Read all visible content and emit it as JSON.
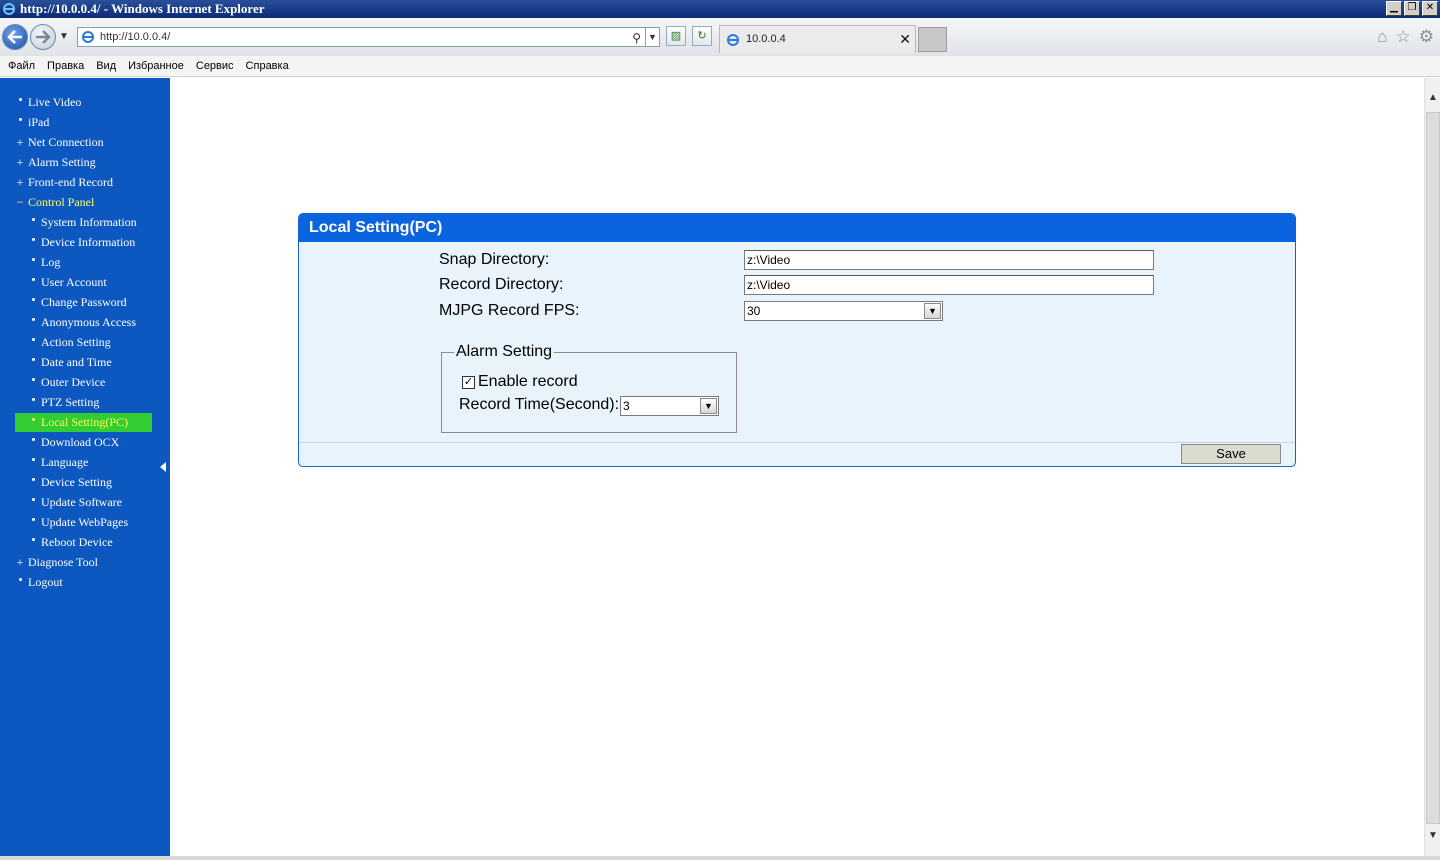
{
  "window": {
    "title": "http://10.0.0.4/ - Windows Internet Explorer",
    "buttons": {
      "minimize": "▁",
      "restore": "❐",
      "close": "✕"
    }
  },
  "browser": {
    "address": "http://10.0.0.4/",
    "tab_title": "10.0.0.4",
    "tab_close": "✕"
  },
  "menu": [
    "Файл",
    "Правка",
    "Вид",
    "Избранное",
    "Сервис",
    "Справка"
  ],
  "sidebar": {
    "items": [
      {
        "label": "Live Video",
        "marker": "•"
      },
      {
        "label": "iPad",
        "marker": "•"
      },
      {
        "label": "Net Connection",
        "marker": "+"
      },
      {
        "label": "Alarm Setting",
        "marker": "+"
      },
      {
        "label": "Front-end Record",
        "marker": "+"
      },
      {
        "label": "Control Panel",
        "marker": "−"
      },
      {
        "label": "System Information",
        "marker": "•"
      },
      {
        "label": "Device Information",
        "marker": "•"
      },
      {
        "label": "Log",
        "marker": "•"
      },
      {
        "label": "User Account",
        "marker": "•"
      },
      {
        "label": "Change Password",
        "marker": "•"
      },
      {
        "label": "Anonymous Access",
        "marker": "•"
      },
      {
        "label": "Action Setting",
        "marker": "•"
      },
      {
        "label": "Date and Time",
        "marker": "•"
      },
      {
        "label": "Outer Device",
        "marker": "•"
      },
      {
        "label": "PTZ Setting",
        "marker": "•"
      },
      {
        "label": "Local Setting(PC)",
        "marker": "•"
      },
      {
        "label": "Download OCX",
        "marker": "•"
      },
      {
        "label": "Language",
        "marker": "•"
      },
      {
        "label": "Device Setting",
        "marker": "•"
      },
      {
        "label": "Update Software",
        "marker": "•"
      },
      {
        "label": "Update WebPages",
        "marker": "•"
      },
      {
        "label": "Reboot Device",
        "marker": "•"
      },
      {
        "label": "Diagnose Tool",
        "marker": "+"
      },
      {
        "label": "Logout",
        "marker": "•"
      }
    ]
  },
  "panel": {
    "title": "Local Setting(PC)",
    "snap_label": "Snap Directory:",
    "snap_value": "z:\\Video",
    "record_label": "Record Directory:",
    "record_value": "z:\\Video",
    "fps_label": "MJPG Record FPS:",
    "fps_value": "30",
    "alarm": {
      "legend": "Alarm Setting",
      "enable_label": "Enable record",
      "enable_checked": true,
      "record_time_label": "Record Time(Second):",
      "record_time_value": "3"
    },
    "save_label": "Save"
  },
  "colors": {
    "sidebar_bg": "#0d58c0",
    "active_item_bg": "#32cd32",
    "active_text": "#ffff55",
    "panel_header": "#0a64e0",
    "panel_bg": "#e8f3fb"
  }
}
